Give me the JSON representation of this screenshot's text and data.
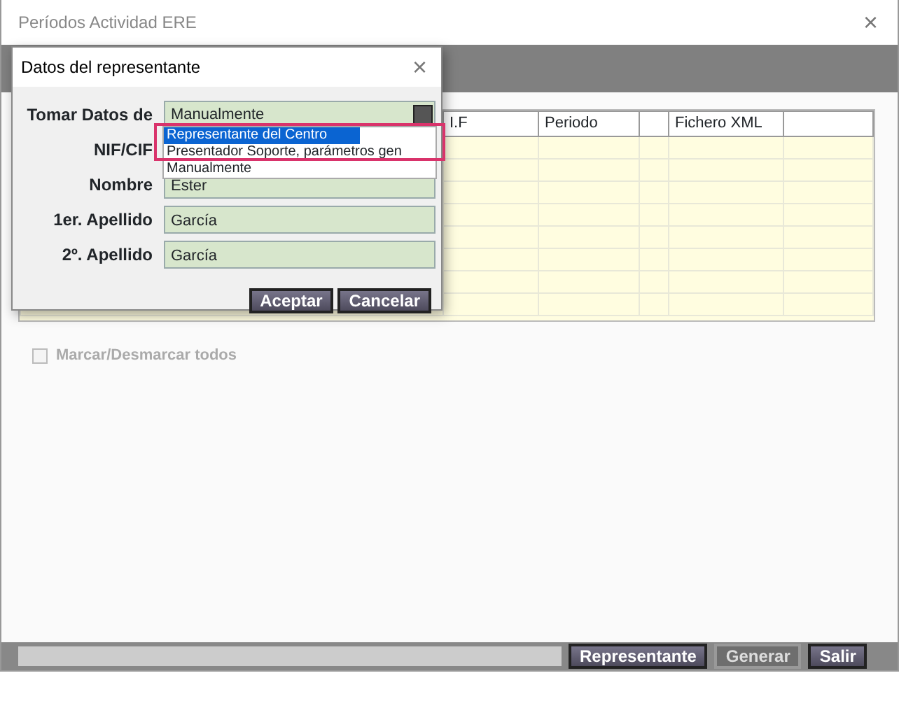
{
  "window": {
    "title": "Períodos Actividad ERE",
    "close": "×"
  },
  "grid": {
    "columns": [
      {
        "label": "I.F"
      },
      {
        "label": "Periodo"
      },
      {},
      {
        "label": "Fichero XML"
      },
      {}
    ]
  },
  "progress": {
    "level": 0
  },
  "select_all": {
    "label": "Marcar/Desmarcar todos",
    "checked": false,
    "disabled": true
  },
  "buttons": [
    {
      "label": "Representante",
      "disabled": false
    },
    {
      "label": "Generar",
      "disabled": true
    },
    {
      "label": "Salir",
      "disabled": false
    }
  ],
  "dialog": {
    "title": "Datos del representante",
    "close": "×",
    "fields": [
      {
        "label": "Tomar Datos de",
        "kind": "select",
        "value": "Manualmente"
      },
      {
        "label": "NIF/CIF",
        "kind": "text"
      },
      {
        "label": "Nombre",
        "kind": "text",
        "value": "Ester"
      },
      {
        "label": "1er. Apellido",
        "kind": "text",
        "value": "García"
      },
      {
        "label": "2º. Apellido",
        "kind": "text",
        "value": "García"
      }
    ],
    "options": [
      {
        "label": "Representante del Centro",
        "selected": true
      },
      {
        "label": "Presentador Soporte, parámetros gen",
        "selected": false
      },
      {
        "label": "Manualmente",
        "selected": false
      }
    ],
    "buttons": [
      {
        "label": "Aceptar"
      },
      {
        "label": "Cancelar"
      }
    ]
  }
}
